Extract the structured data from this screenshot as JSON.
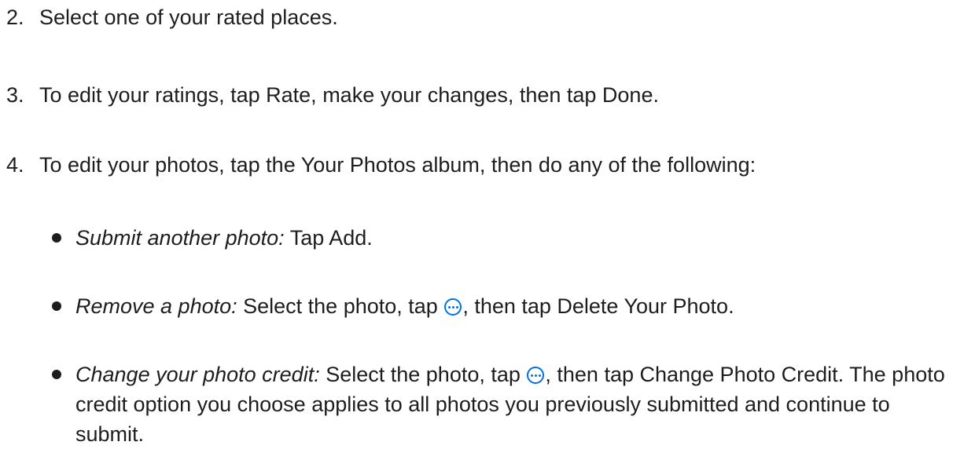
{
  "steps": [
    {
      "number": "2.",
      "text": "Select one of your rated places."
    },
    {
      "number": "3.",
      "text": "To edit your ratings, tap Rate, make your changes, then tap Done."
    },
    {
      "number": "4.",
      "text": "To edit your photos, tap the Your Photos album, then do any of the following:"
    }
  ],
  "substeps": [
    {
      "label": "Submit another photo:",
      "text": " Tap Add."
    },
    {
      "label": "Remove a photo:",
      "text_before": " Select the photo, tap ",
      "icon": "more-icon",
      "text_after": ", then tap Delete Your Photo."
    },
    {
      "label": "Change your photo credit:",
      "text_before": " Select the photo, tap ",
      "icon": "more-icon",
      "text_after": ", then tap Change Photo Credit. The photo credit option you choose applies to all photos you previously submitted and continue to submit."
    }
  ],
  "colors": {
    "text": "#1d1d1f",
    "accent": "#0071e3"
  }
}
